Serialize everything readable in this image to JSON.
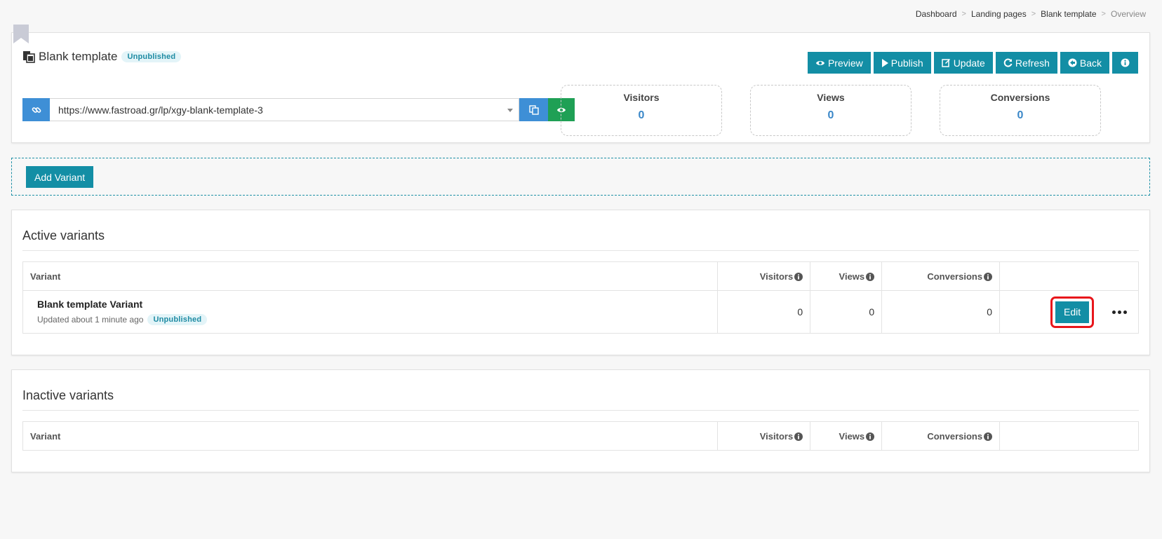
{
  "breadcrumb": {
    "items": [
      "Dashboard",
      "Landing pages",
      "Blank template"
    ],
    "current": "Overview"
  },
  "page": {
    "title": "Blank template",
    "status": "Unpublished"
  },
  "toolbar": {
    "preview": "Preview",
    "publish": "Publish",
    "update": "Update",
    "refresh": "Refresh",
    "back": "Back"
  },
  "url": {
    "value": "https://www.fastroad.gr/lp/xgy-blank-template-3"
  },
  "stats": {
    "visitors": {
      "label": "Visitors",
      "value": "0"
    },
    "views": {
      "label": "Views",
      "value": "0"
    },
    "conversions": {
      "label": "Conversions",
      "value": "0"
    }
  },
  "add_variant_label": "Add Variant",
  "active": {
    "title": "Active variants",
    "columns": {
      "variant": "Variant",
      "visitors": "Visitors",
      "views": "Views",
      "conversions": "Conversions"
    },
    "rows": [
      {
        "name": "Blank template Variant",
        "updated": "Updated about 1 minute ago",
        "status": "Unpublished",
        "visitors": "0",
        "views": "0",
        "conversions": "0",
        "edit_label": "Edit"
      }
    ]
  },
  "inactive": {
    "title": "Inactive variants",
    "columns": {
      "variant": "Variant",
      "visitors": "Visitors",
      "views": "Views",
      "conversions": "Conversions"
    }
  },
  "colors": {
    "primary": "#138ea5",
    "link_blue": "#3e8fd6",
    "success": "#1fa055",
    "highlight": "#e8161b"
  },
  "icons": {
    "bookmark": "bookmark-icon",
    "title": "copy-document-icon",
    "preview": "eye-icon",
    "publish": "play-icon",
    "update": "edit-icon",
    "refresh": "refresh-icon",
    "back": "arrow-circle-left-icon",
    "info": "info-icon",
    "link": "link-icon",
    "copy": "copy-icon",
    "view": "eye-icon",
    "more": "ellipsis-icon"
  }
}
